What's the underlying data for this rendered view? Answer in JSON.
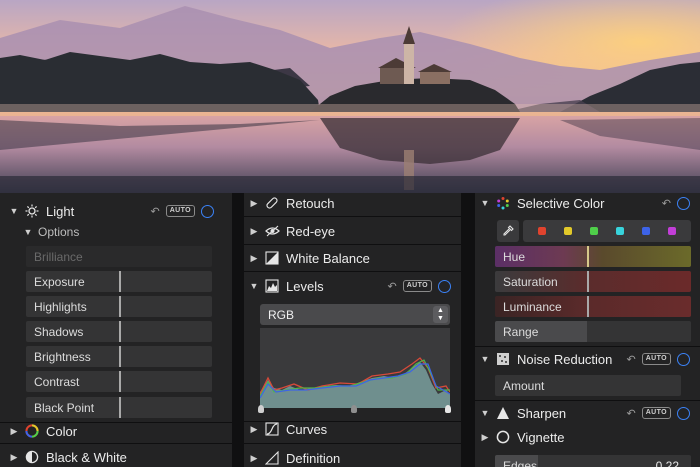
{
  "col_left": {
    "light": {
      "label": "Light",
      "auto": "AUTO"
    },
    "options": {
      "label": "Options"
    },
    "sliders": [
      {
        "label": "Brilliance",
        "disabled": true,
        "level": 0.5
      },
      {
        "label": "Exposure",
        "level": 0.5
      },
      {
        "label": "Highlights",
        "level": 0.5
      },
      {
        "label": "Shadows",
        "level": 0.5
      },
      {
        "label": "Brightness",
        "level": 0.5
      },
      {
        "label": "Contrast",
        "level": 0.5
      },
      {
        "label": "Black Point",
        "level": 0.5
      }
    ],
    "color": {
      "label": "Color"
    },
    "bw": {
      "label": "Black & White"
    }
  },
  "col_mid": {
    "retouch": {
      "label": "Retouch"
    },
    "redeye": {
      "label": "Red-eye"
    },
    "white_balance": {
      "label": "White Balance"
    },
    "levels": {
      "label": "Levels",
      "auto": "AUTO"
    },
    "channel": {
      "value": "RGB"
    },
    "curves": {
      "label": "Curves"
    },
    "definition": {
      "label": "Definition"
    }
  },
  "col_right": {
    "selective_color": {
      "label": "Selective Color"
    },
    "swatches": [
      "#e0432e",
      "#e2c92a",
      "#4fcf4a",
      "#38d3dc",
      "#3d63e8",
      "#c23ed8"
    ],
    "hue": {
      "label": "Hue"
    },
    "saturation": {
      "label": "Saturation"
    },
    "luminance": {
      "label": "Luminance"
    },
    "range": {
      "label": "Range"
    },
    "noise": {
      "label": "Noise Reduction",
      "auto": "AUTO"
    },
    "amount": {
      "label": "Amount"
    },
    "sharpen": {
      "label": "Sharpen",
      "auto": "AUTO"
    },
    "vignette": {
      "label": "Vignette"
    },
    "edges": {
      "label": "Edges",
      "value": "0.22"
    }
  },
  "colors": {
    "accent": "#3b82f6",
    "panel": "#232324",
    "slider": "#343435"
  }
}
